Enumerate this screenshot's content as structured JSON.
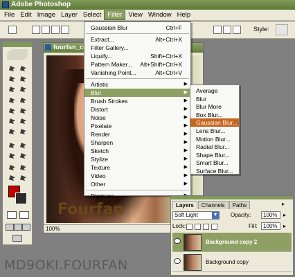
{
  "app": {
    "title": "Adobe Photoshop"
  },
  "menubar": [
    "File",
    "Edit",
    "Image",
    "Layer",
    "Select",
    "Filter",
    "View",
    "Window",
    "Help"
  ],
  "options": {
    "style_label": "Style:"
  },
  "document": {
    "title": "fourfan_co...",
    "zoom": "100%",
    "watermark": "Fourfan"
  },
  "filter_menu": {
    "top": [
      {
        "label": "Gaussian Blur",
        "shortcut": "Ctrl+F"
      }
    ],
    "middle": [
      {
        "label": "Extract...",
        "shortcut": "Alt+Ctrl+X"
      },
      {
        "label": "Filter Gallery...",
        "shortcut": ""
      },
      {
        "label": "Liquify...",
        "shortcut": "Shift+Ctrl+X"
      },
      {
        "label": "Pattern Maker...",
        "shortcut": "Alt+Shift+Ctrl+X"
      },
      {
        "label": "Vanishing Point...",
        "shortcut": "Alt+Ctrl+V"
      }
    ],
    "submenus": [
      "Artistic",
      "Blur",
      "Brush Strokes",
      "Distort",
      "Noise",
      "Pixelate",
      "Render",
      "Sharpen",
      "Sketch",
      "Stylize",
      "Texture",
      "Video",
      "Other"
    ],
    "bottom": [
      "Digimarc"
    ]
  },
  "blur_menu": [
    "Average",
    "Blur",
    "Blur More",
    "Box Blur...",
    "Gaussian Blur...",
    "Lens Blur...",
    "Motion Blur...",
    "Radial Blur...",
    "Shape Blur...",
    "Smart Blur...",
    "Surface Blur..."
  ],
  "layers_panel": {
    "tabs": [
      "Layers",
      "Channels",
      "Paths"
    ],
    "blend_mode": "Soft Light",
    "opacity_label": "Opacity:",
    "opacity": "100%",
    "lock_label": "Lock:",
    "fill_label": "Fill:",
    "fill": "100%",
    "layers": [
      "Background copy 2",
      "Background copy"
    ]
  },
  "watermark": "MD9OKI.FOURFAN"
}
